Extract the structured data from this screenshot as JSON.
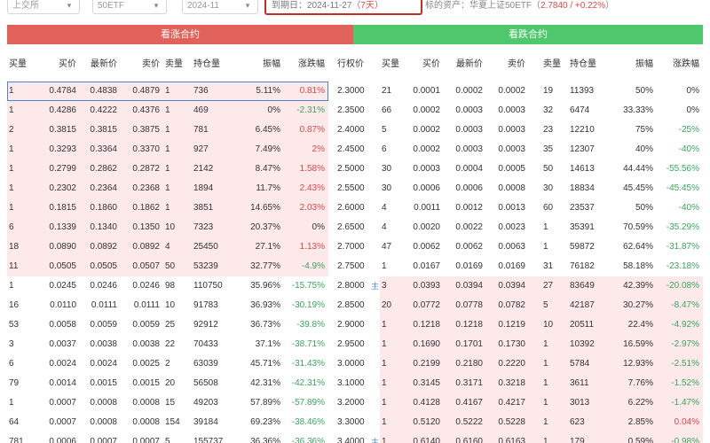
{
  "toolbar": {
    "market": "上交所",
    "etf": "50ETF",
    "month": "2024-11",
    "expiry_label": "到期日：2024-11-27",
    "expiry_days": "（7天）",
    "underlying_label": "标的资产：华夏上证50ETF（",
    "underlying_price": "2.7840 / +0.22%",
    "underlying_close": "）"
  },
  "bands": {
    "call": "看涨合约",
    "put": "看跌合约"
  },
  "headers": {
    "call": [
      "买量",
      "买价",
      "最新价",
      "卖价",
      "卖量",
      "持仓量",
      "振幅",
      "涨跌幅"
    ],
    "strike": "行权价",
    "put": [
      "买量",
      "买价",
      "最新价",
      "卖价",
      "卖量",
      "持仓量",
      "振幅",
      "涨跌幅"
    ]
  },
  "rows": [
    {
      "call": [
        "1",
        "0.4784",
        "0.4838",
        "0.4879",
        "1",
        "736",
        "5.11%",
        "0.81%"
      ],
      "cc": "up",
      "strike": "2.3000",
      "put": [
        "21",
        "0.0001",
        "0.0002",
        "0.0002",
        "19",
        "11393",
        "50%",
        "0%"
      ],
      "pc": "neutral",
      "itm_call": true,
      "itm_put": false,
      "selected": true
    },
    {
      "call": [
        "1",
        "0.4286",
        "0.4222",
        "0.4376",
        "1",
        "469",
        "0%",
        "-2.31%"
      ],
      "cc": "down",
      "strike": "2.3500",
      "put": [
        "66",
        "0.0002",
        "0.0003",
        "0.0003",
        "32",
        "6474",
        "33.33%",
        "0%"
      ],
      "pc": "neutral",
      "itm_call": true,
      "itm_put": false
    },
    {
      "call": [
        "2",
        "0.3815",
        "0.3815",
        "0.3875",
        "1",
        "781",
        "6.45%",
        "0.87%"
      ],
      "cc": "up",
      "strike": "2.4000",
      "put": [
        "5",
        "0.0002",
        "0.0003",
        "0.0003",
        "23",
        "12210",
        "75%",
        "-25%"
      ],
      "pc": "down",
      "itm_call": true,
      "itm_put": false
    },
    {
      "call": [
        "1",
        "0.3293",
        "0.3364",
        "0.3370",
        "1",
        "927",
        "7.49%",
        "2%"
      ],
      "cc": "up",
      "strike": "2.4500",
      "put": [
        "6",
        "0.0002",
        "0.0003",
        "0.0003",
        "35",
        "12307",
        "40%",
        "-40%"
      ],
      "pc": "down",
      "itm_call": true,
      "itm_put": false
    },
    {
      "call": [
        "1",
        "0.2799",
        "0.2862",
        "0.2872",
        "1",
        "2142",
        "8.47%",
        "1.58%"
      ],
      "cc": "up",
      "strike": "2.5000",
      "put": [
        "30",
        "0.0003",
        "0.0004",
        "0.0005",
        "50",
        "14613",
        "44.44%",
        "-55.56%"
      ],
      "pc": "down",
      "itm_call": true,
      "itm_put": false
    },
    {
      "call": [
        "1",
        "0.2302",
        "0.2364",
        "0.2368",
        "1",
        "1894",
        "11.7%",
        "2.43%"
      ],
      "cc": "up",
      "strike": "2.5500",
      "put": [
        "30",
        "0.0006",
        "0.0006",
        "0.0008",
        "30",
        "18834",
        "45.45%",
        "-45.45%"
      ],
      "pc": "down",
      "itm_call": true,
      "itm_put": false
    },
    {
      "call": [
        "1",
        "0.1815",
        "0.1860",
        "0.1862",
        "1",
        "3851",
        "14.65%",
        "2.03%"
      ],
      "cc": "up",
      "strike": "2.6000",
      "put": [
        "4",
        "0.0011",
        "0.0012",
        "0.0013",
        "60",
        "23537",
        "50%",
        "-40%"
      ],
      "pc": "down",
      "itm_call": true,
      "itm_put": false
    },
    {
      "call": [
        "6",
        "0.1339",
        "0.1340",
        "0.1350",
        "10",
        "7323",
        "20.37%",
        "0%"
      ],
      "cc": "neutral",
      "strike": "2.6500",
      "put": [
        "4",
        "0.0020",
        "0.0022",
        "0.0023",
        "1",
        "35391",
        "70.59%",
        "-35.29%"
      ],
      "pc": "down",
      "itm_call": true,
      "itm_put": false
    },
    {
      "call": [
        "18",
        "0.0890",
        "0.0892",
        "0.0892",
        "4",
        "25450",
        "27.1%",
        "1.13%"
      ],
      "cc": "up",
      "strike": "2.7000",
      "put": [
        "47",
        "0.0062",
        "0.0062",
        "0.0063",
        "1",
        "59872",
        "62.64%",
        "-31.87%"
      ],
      "pc": "down",
      "itm_call": true,
      "itm_put": false
    },
    {
      "call": [
        "11",
        "0.0505",
        "0.0505",
        "0.0507",
        "50",
        "53239",
        "32.77%",
        "-4.9%"
      ],
      "cc": "down",
      "strike": "2.7500",
      "put": [
        "1",
        "0.0167",
        "0.0169",
        "0.0169",
        "31",
        "76182",
        "58.18%",
        "-23.18%"
      ],
      "pc": "down",
      "itm_call": true,
      "itm_put": false
    },
    {
      "call": [
        "1",
        "0.0245",
        "0.0246",
        "0.0246",
        "98",
        "110750",
        "35.96%",
        "-15.75%"
      ],
      "cc": "down",
      "strike": "2.8000",
      "put": [
        "3",
        "0.0393",
        "0.0394",
        "0.0394",
        "27",
        "83649",
        "42.39%",
        "-20.08%"
      ],
      "pc": "down",
      "itm_call": false,
      "itm_put": true,
      "marker": "主"
    },
    {
      "call": [
        "16",
        "0.0110",
        "0.0111",
        "0.0111",
        "10",
        "91783",
        "36.93%",
        "-30.19%"
      ],
      "cc": "down",
      "strike": "2.8500",
      "put": [
        "20",
        "0.0772",
        "0.0778",
        "0.0782",
        "5",
        "42187",
        "30.27%",
        "-8.47%"
      ],
      "pc": "down",
      "itm_call": false,
      "itm_put": true
    },
    {
      "call": [
        "53",
        "0.0058",
        "0.0059",
        "0.0059",
        "25",
        "92912",
        "36.73%",
        "-39.8%"
      ],
      "cc": "down",
      "strike": "2.9000",
      "put": [
        "1",
        "0.1218",
        "0.1218",
        "0.1219",
        "10",
        "20511",
        "22.4%",
        "-4.92%"
      ],
      "pc": "down",
      "itm_call": false,
      "itm_put": true
    },
    {
      "call": [
        "3",
        "0.0037",
        "0.0038",
        "0.0038",
        "22",
        "70433",
        "37.1%",
        "-38.71%"
      ],
      "cc": "down",
      "strike": "2.9500",
      "put": [
        "1",
        "0.1690",
        "0.1701",
        "0.1730",
        "1",
        "10392",
        "16.59%",
        "-2.97%"
      ],
      "pc": "down",
      "itm_call": false,
      "itm_put": true
    },
    {
      "call": [
        "6",
        "0.0024",
        "0.0024",
        "0.0025",
        "2",
        "63039",
        "45.71%",
        "-31.43%"
      ],
      "cc": "down",
      "strike": "3.0000",
      "put": [
        "1",
        "0.2199",
        "0.2180",
        "0.2220",
        "1",
        "5784",
        "12.93%",
        "-2.51%"
      ],
      "pc": "down",
      "itm_call": false,
      "itm_put": true
    },
    {
      "call": [
        "79",
        "0.0014",
        "0.0015",
        "0.0015",
        "20",
        "56508",
        "42.31%",
        "-42.31%"
      ],
      "cc": "down",
      "strike": "3.1000",
      "put": [
        "1",
        "0.3145",
        "0.3171",
        "0.3218",
        "1",
        "3611",
        "7.76%",
        "-1.52%"
      ],
      "pc": "down",
      "itm_call": false,
      "itm_put": true
    },
    {
      "call": [
        "1",
        "0.0007",
        "0.0008",
        "0.0008",
        "15",
        "49203",
        "57.89%",
        "-57.89%"
      ],
      "cc": "down",
      "strike": "3.2000",
      "put": [
        "1",
        "0.4128",
        "0.4167",
        "0.4217",
        "1",
        "3013",
        "6.22%",
        "-1.47%"
      ],
      "pc": "down",
      "itm_call": false,
      "itm_put": true
    },
    {
      "call": [
        "64",
        "0.0007",
        "0.0008",
        "0.0008",
        "154",
        "39184",
        "69.23%",
        "-38.46%"
      ],
      "cc": "down",
      "strike": "3.3000",
      "put": [
        "1",
        "0.5120",
        "0.5222",
        "0.5228",
        "1",
        "623",
        "2.85%",
        "0.04%"
      ],
      "pc": "up",
      "itm_call": false,
      "itm_put": true
    },
    {
      "call": [
        "781",
        "0.0006",
        "0.0007",
        "0.0007",
        "5",
        "155737",
        "36.36%",
        "-36.36%"
      ],
      "cc": "down",
      "strike": "3.4000",
      "put": [
        "1",
        "0.6140",
        "0.6160",
        "0.6163",
        "1",
        "179",
        "0.59%",
        "-0.98%"
      ],
      "pc": "down",
      "itm_call": false,
      "itm_put": true,
      "marker": "主"
    }
  ]
}
